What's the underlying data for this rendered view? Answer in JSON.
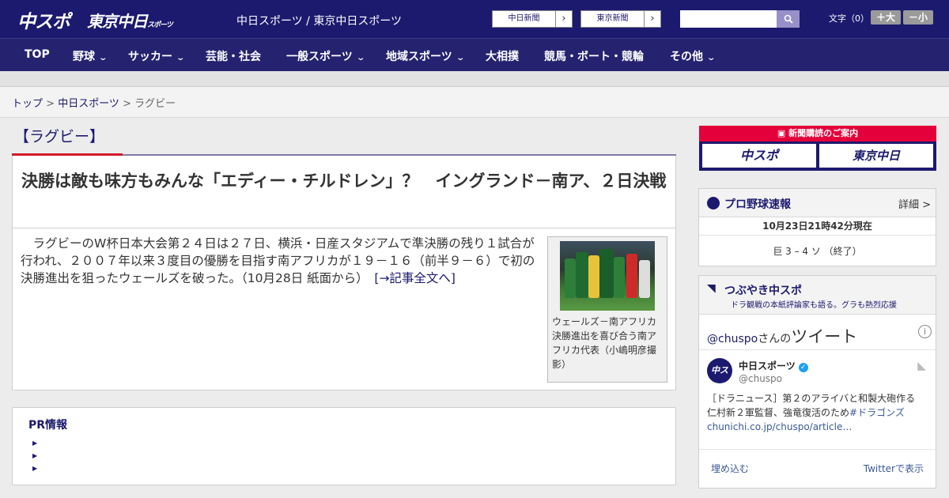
{
  "header": {
    "logo1": "中スポ",
    "logo2": "東京中日",
    "logo2_small": "スポーツ",
    "site_name": "中日スポーツ / 東京中日スポーツ",
    "paper1": "中日新聞",
    "paper2": "東京新聞",
    "arrow": "›",
    "search_value": "",
    "font_size_label": "文字（0）",
    "font_bigger": "＋大",
    "font_smaller": "－小"
  },
  "nav": {
    "items": [
      "TOP",
      "野球",
      "サッカー",
      "芸能・社会",
      "一般スポーツ",
      "地域スポーツ",
      "大相撲",
      "競馬・ボート・競輪",
      "その他"
    ],
    "chevron": "⌄"
  },
  "breadcrumb": {
    "home": "トップ",
    "sep1": " > ",
    "section": "中日スポーツ",
    "sep2": " > ",
    "current": "ラグビー"
  },
  "article": {
    "category": "【ラグビー】",
    "headline": "決勝は敵も味方もみんな「エディー・チルドレン」？　イングランド－南ア、２日決戦",
    "lead": "　ラグビーのW杯日本大会第２４日は２７日、横浜・日産スタジアムで準決勝の残り１試合が行われ、２００７年以来３度目の優勝を目指す南アフリカが１９－１６（前半９－６）で初の決勝進出を狙ったウェールズを破った。（10月28日 紙面から）　",
    "more_link": "[→記事全文へ]",
    "caption": "ウェールズ－南アフリカ　決勝進出を喜び合う南アフリカ代表（小嶋明彦撮影）"
  },
  "pr": {
    "title": "PR情報",
    "bullet": "▶"
  },
  "sidebar": {
    "ad": {
      "top": "新聞購読のご案内",
      "btn1": "中スポ",
      "btn2": "東京中日"
    },
    "baseball": {
      "title": "プロ野球速報",
      "more": "詳細 >",
      "timestamp": "10月23日21時42分現在",
      "score": "巨 3 – 4 ソ （終了）"
    },
    "tsubuyaki": {
      "title": "つぶやき中スポ",
      "subtitle": "ドラ観戦の本紙評論家も語る。グラも熱烈応援",
      "handle_link": "@chuspo",
      "san": "さんの",
      "tweet_label": "ツイート",
      "info": "i",
      "user_name": "中日スポーツ",
      "user_handle": "@chuspo",
      "verified": "✓",
      "avatar": "中スポ",
      "tweet_text": "［ドラニュース］第２のアライバと和製大砲作る 仁村新２軍監督、強竜復活のため",
      "tweet_hashtag": "#ドラゴンズ",
      "tweet_link": "chunichi.co.jp/chuspo/article…",
      "embed": "埋め込む",
      "view_on_twitter": "Twitterで表示"
    }
  }
}
